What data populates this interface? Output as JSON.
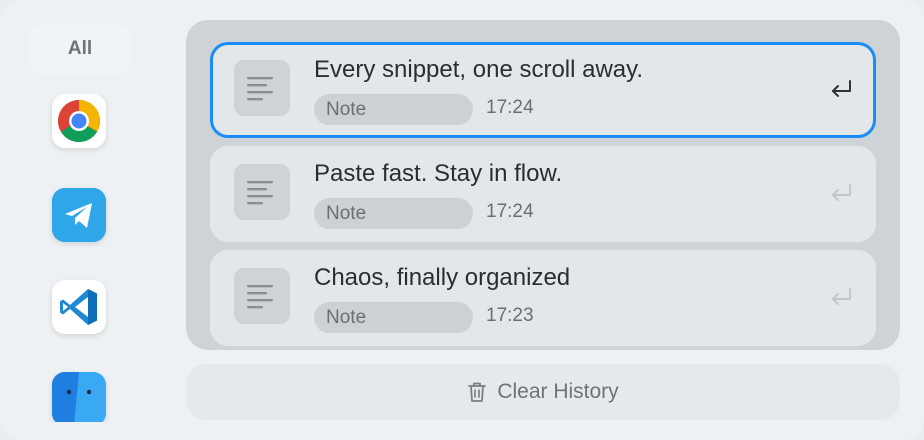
{
  "sidebar": {
    "all_label": "All",
    "apps": [
      {
        "icon": "chrome-icon"
      },
      {
        "icon": "telegram-icon"
      },
      {
        "icon": "vscode-icon"
      },
      {
        "icon": "finder-icon"
      }
    ]
  },
  "clips": [
    {
      "title": "Every snippet, one scroll away.",
      "type": "Note",
      "time": "17:24",
      "selected": true
    },
    {
      "title": "Paste fast. Stay in flow.",
      "type": "Note",
      "time": "17:24",
      "selected": false
    },
    {
      "title": "Chaos, finally organized",
      "type": "Note",
      "time": "17:23",
      "selected": false
    }
  ],
  "footer": {
    "clear_label": "Clear History"
  },
  "colors": {
    "accent": "#1a8cf5"
  }
}
